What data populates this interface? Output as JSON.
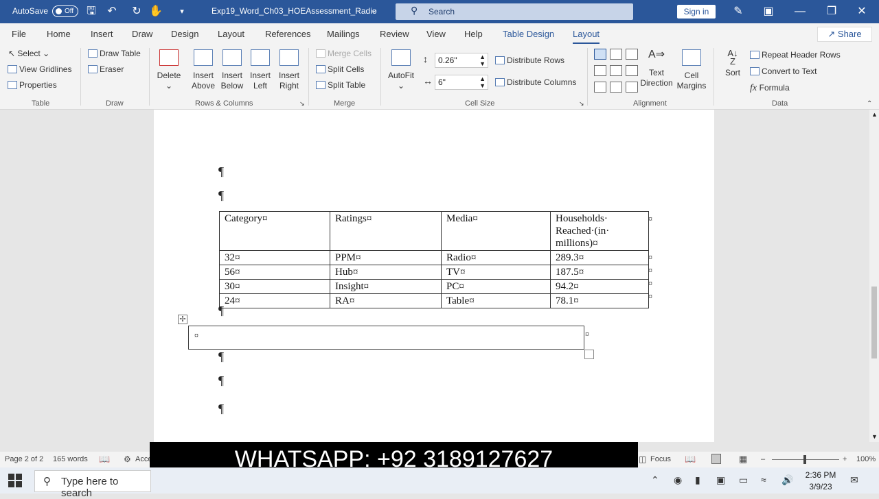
{
  "titlebar": {
    "autosave_label": "AutoSave",
    "autosave_state": "Off",
    "document": "Exp19_Word_Ch03_HOEAssessment_Radio",
    "search_placeholder": "Search",
    "signin": "Sign in"
  },
  "menu": {
    "items": [
      "File",
      "Home",
      "Insert",
      "Draw",
      "Design",
      "Layout",
      "References",
      "Mailings",
      "Review",
      "View",
      "Help",
      "Table Design",
      "Layout"
    ],
    "share": "Share"
  },
  "ribbon": {
    "table": {
      "select": "Select",
      "view_gridlines": "View Gridlines",
      "properties": "Properties",
      "label": "Table"
    },
    "draw": {
      "draw_table": "Draw Table",
      "eraser": "Eraser",
      "label": "Draw"
    },
    "rows_columns": {
      "delete": "Delete",
      "insert_above_1": "Insert",
      "insert_above_2": "Above",
      "insert_below_1": "Insert",
      "insert_below_2": "Below",
      "insert_left_1": "Insert",
      "insert_left_2": "Left",
      "insert_right_1": "Insert",
      "insert_right_2": "Right",
      "label": "Rows & Columns"
    },
    "merge": {
      "merge_cells": "Merge Cells",
      "split_cells": "Split Cells",
      "split_table": "Split Table",
      "label": "Merge"
    },
    "cell_size": {
      "autofit": "AutoFit",
      "height": "0.26\"",
      "width": "6\"",
      "distribute_rows": "Distribute Rows",
      "distribute_columns": "Distribute Columns",
      "label": "Cell Size"
    },
    "alignment": {
      "text_direction_1": "Text",
      "text_direction_2": "Direction",
      "cell_margins_1": "Cell",
      "cell_margins_2": "Margins",
      "label": "Alignment"
    },
    "data": {
      "sort": "Sort",
      "repeat_header_rows": "Repeat Header Rows",
      "convert_to_text": "Convert to Text",
      "formula": "Formula",
      "label": "Data"
    }
  },
  "document": {
    "pilcrow": "¶",
    "cell_mark": "¤",
    "table": {
      "headers": [
        "Category¤",
        "Ratings¤",
        "Media¤",
        "Households· Reached·(in· millions)¤"
      ],
      "rows": [
        [
          "32¤",
          "PPM¤",
          "Radio¤",
          "289.3¤"
        ],
        [
          "56¤",
          "Hub¤",
          "TV¤",
          "187.5¤"
        ],
        [
          "30¤",
          "Insight¤",
          "PC¤",
          "94.2¤"
        ],
        [
          "24¤",
          "RA¤",
          "Table¤",
          "78.1¤"
        ]
      ]
    }
  },
  "statusbar": {
    "page": "Page 2 of 2",
    "words": "165 words",
    "accessibility": "Acce",
    "focus": "Focus",
    "zoom": "100%"
  },
  "banner": {
    "text": "WHATSAPP:   +92 3189127627"
  },
  "taskbar": {
    "search_placeholder": "Type here to search",
    "time": "2:36 PM",
    "date": "3/9/23"
  }
}
